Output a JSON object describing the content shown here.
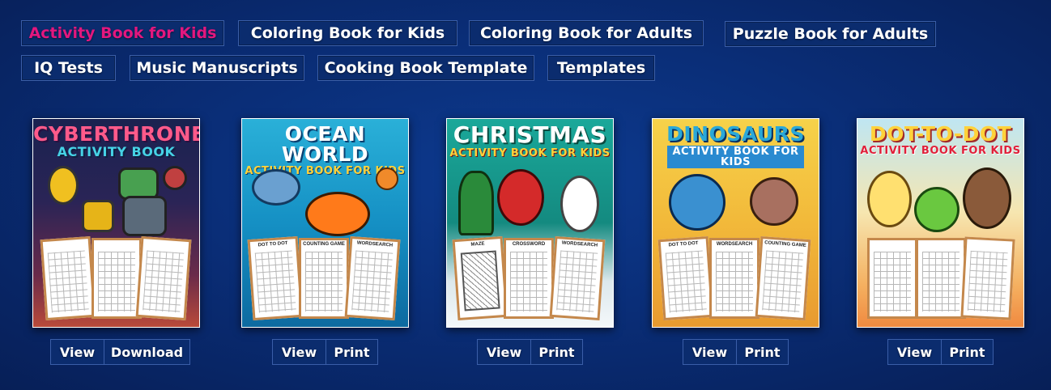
{
  "categories": [
    {
      "label": "Activity Book for Kids",
      "active": true
    },
    {
      "label": "Coloring Book for Kids",
      "active": false
    },
    {
      "label": "Coloring Book for Adults",
      "active": false
    },
    {
      "label": "Puzzle Book for Adults",
      "active": false
    },
    {
      "label": "IQ Tests",
      "active": false
    },
    {
      "label": "Music Manuscripts",
      "active": false
    },
    {
      "label": "Cooking Book Template",
      "active": false
    },
    {
      "label": "Templates",
      "active": false
    }
  ],
  "books": [
    {
      "title_line1": "CYBERTHRONE",
      "title_line2": "ACTIVITY BOOK",
      "buttons": [
        "View",
        "Download"
      ]
    },
    {
      "title_line1": "OCEAN WORLD",
      "title_line2": "ACTIVITY BOOK FOR KIDS",
      "page_labels": [
        "DOT TO DOT",
        "COUNTING GAME",
        "WORDSEARCH"
      ],
      "buttons": [
        "View",
        "Print"
      ]
    },
    {
      "title_line1": "CHRISTMAS",
      "title_line2": "ACTIVITY BOOK FOR KIDS",
      "page_labels": [
        "MAZE",
        "CROSSWORD",
        "WORDSEARCH"
      ],
      "buttons": [
        "View",
        "Print"
      ]
    },
    {
      "title_line1": "DINOSAURS",
      "title_line2": "ACTIVITY BOOK FOR KIDS",
      "page_labels": [
        "DOT TO DOT",
        "WORDSEARCH",
        "COUNTING GAME"
      ],
      "buttons": [
        "View",
        "Print"
      ]
    },
    {
      "title_line1": "DOT-TO-DOT",
      "title_line2": "ACTIVITY BOOK FOR KIDS",
      "buttons": [
        "View",
        "Print"
      ]
    }
  ],
  "colors": {
    "active_tag": "#e3177e",
    "background": "#0a2e78",
    "button_border": "#3a5ea8"
  }
}
